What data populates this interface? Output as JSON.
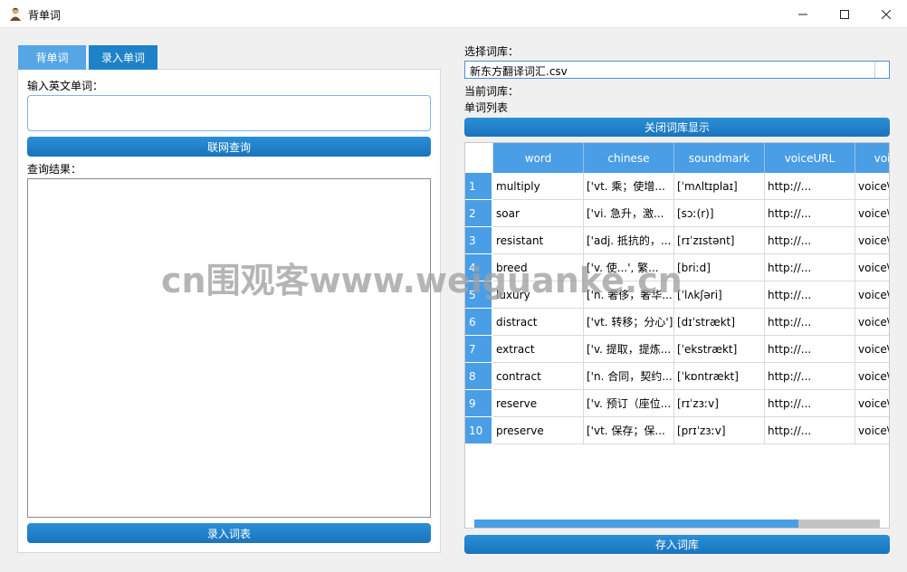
{
  "window": {
    "title": "背单词",
    "controls": {
      "minimize": "—",
      "maximize": "☐",
      "close": "✕"
    }
  },
  "tabs": [
    {
      "label": "背单词"
    },
    {
      "label": "录入单词"
    }
  ],
  "left": {
    "input_label": "输入英文单词：",
    "input_value": "",
    "query_button": "联网查询",
    "result_label": "查询结果：",
    "record_button": "录入词表"
  },
  "right": {
    "select_label": "选择词库：",
    "combo_value": "新东方翻译词汇.csv",
    "current_label": "当前词库：",
    "list_label": "单词列表",
    "close_button": "关闭词库显示",
    "save_button": "存入词库"
  },
  "table": {
    "columns": [
      "word",
      "chinese",
      "soundmark",
      "voiceURL",
      "voi"
    ],
    "rows": [
      [
        "1",
        "multiply",
        "['vt. 乘；使增...",
        "[ˈmʌltɪplaɪ]",
        "http://...",
        "voice\\"
      ],
      [
        "2",
        "soar",
        "['vi. 急升，激...",
        "[sɔː(r)]",
        "http://...",
        "voice\\"
      ],
      [
        "3",
        "resistant",
        "['adj. 抵抗的，...",
        "[rɪˈzɪstənt]",
        "http://...",
        "voice\\"
      ],
      [
        "4",
        "breed",
        "['v. 使...', 繁...",
        "[briːd]",
        "http://...",
        "voice\\"
      ],
      [
        "5",
        "luxury",
        "['n. 奢侈，奢华...",
        "[ˈlʌkʃəri]",
        "http://...",
        "voice\\"
      ],
      [
        "6",
        "distract",
        "['vt. 转移；分心']",
        "[dɪˈstrækt]",
        "http://...",
        "voice\\"
      ],
      [
        "7",
        "extract",
        "['v. 提取，提炼...",
        "[ˈekstrækt]",
        "http://...",
        "voice\\"
      ],
      [
        "8",
        "contract",
        "['n. 合同，契约...",
        "[ˈkɒntrækt]",
        "http://...",
        "voice\\"
      ],
      [
        "9",
        "reserve",
        "['v. 预订（座位...",
        "[rɪˈzɜːv]",
        "http://...",
        "voice\\"
      ],
      [
        "10",
        "preserve",
        "['vt. 保存；保...",
        "[prɪˈzɜːv]",
        "http://...",
        "voice\\"
      ]
    ]
  },
  "watermark": "cn围观客www.weiguanke.cn",
  "colors": {
    "accent": "#1e82c8",
    "tab_inactive": "#56a6e6",
    "header": "#4a9ee6"
  }
}
